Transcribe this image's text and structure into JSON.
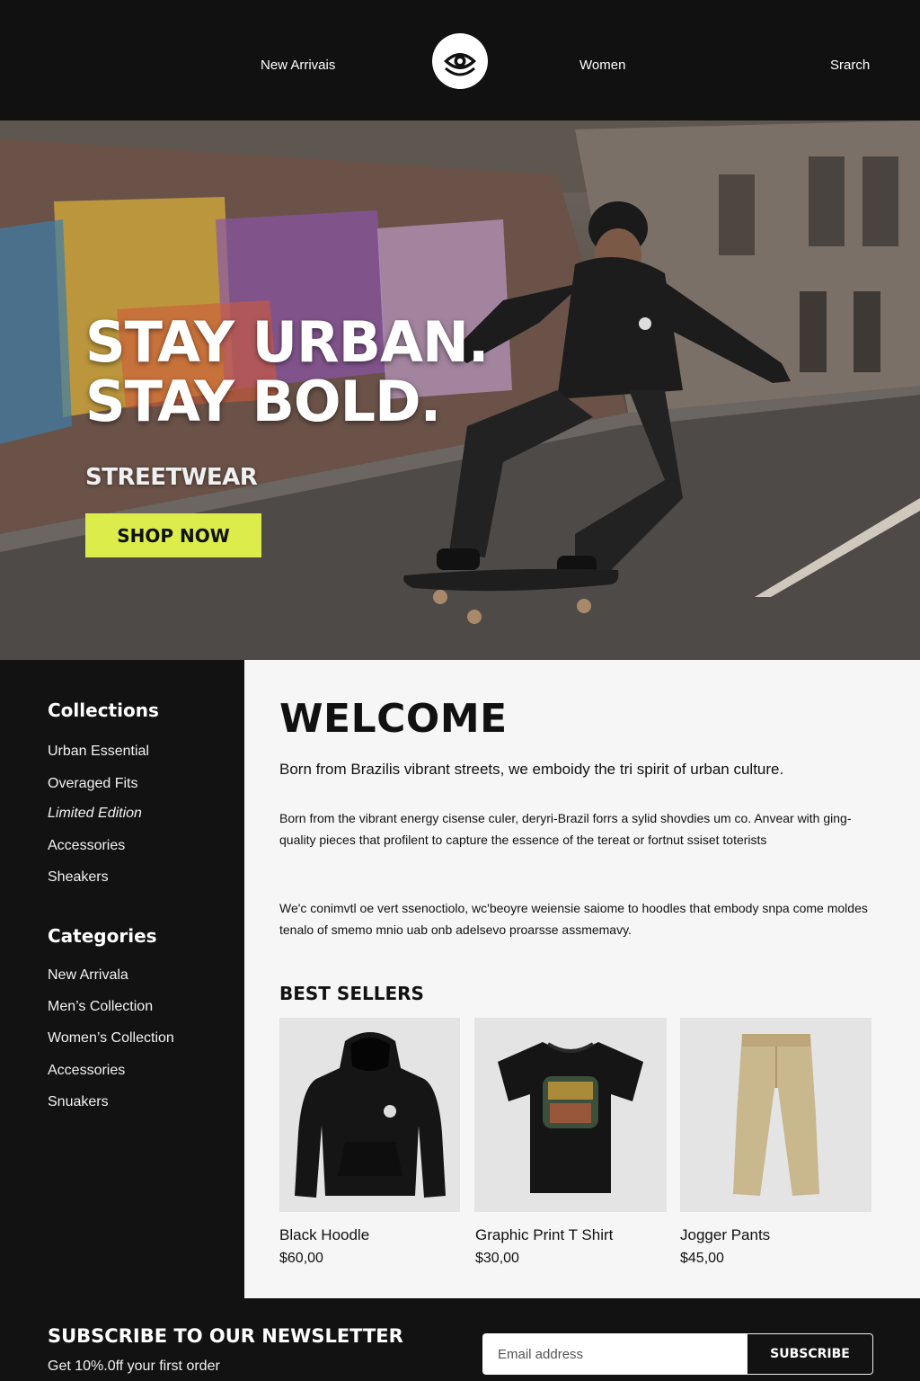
{
  "header": {
    "nav_left": "New Arrivais",
    "nav_center": "Women",
    "nav_right": "Srarch",
    "logo_icon": "eye-logo-icon"
  },
  "hero": {
    "title_line1": "STAY URBAN.",
    "title_line2": "STAY BOLD.",
    "subtitle": "STREETWEAR",
    "cta_label": "SHOP NOW",
    "cta_color": "#dcec4a"
  },
  "sidebar": {
    "collections_heading": "Collections",
    "collections": [
      "Urban Essential",
      "Overaged Fits",
      "Limited Edition",
      "Accessories",
      "Sheakers"
    ],
    "categories_heading": "Categories",
    "categories": [
      "New Arrivala",
      "Men’s Collection",
      "Women’s Collection",
      "Accessories",
      "Snuakers"
    ]
  },
  "main": {
    "welcome_heading": "WELCOME",
    "lead": "Born from Brazilis vibrant streets, we emboidy the tri spirit of urban culture.",
    "para1": "Born from the vibrant energy cisense culer, deryri-Brazil forrs a sylid shovdies um co. Anvear with ging-quality pieces that profilent to capture the essence of the tereat or fortnut ssiset toterists",
    "para2": "We'c conimvtl oe vert ssenoctiolo, wc'beoyre weiensie saiome to hoodles that embody snpa come moldes tenalo of smemo mnio uab onb adelsevo proarsse assmemavy.",
    "best_sellers_heading": "BEST SELLERS",
    "products": [
      {
        "name": "Black Hoodle",
        "price": "$60,00",
        "icon": "hoodie-icon"
      },
      {
        "name": "Graphic Print T Shirt",
        "price": "$30,00",
        "icon": "tshirt-icon"
      },
      {
        "name": "Jogger Pants",
        "price": "$45,00",
        "icon": "pants-icon"
      }
    ]
  },
  "footer": {
    "newsletter_title": "SUBSCRIBE TO OUR NEWSLETTER",
    "newsletter_sub": "Get 10%.0ff your first order",
    "email_placeholder": "Email address",
    "subscribe_label": "SUBSCRIBE"
  }
}
